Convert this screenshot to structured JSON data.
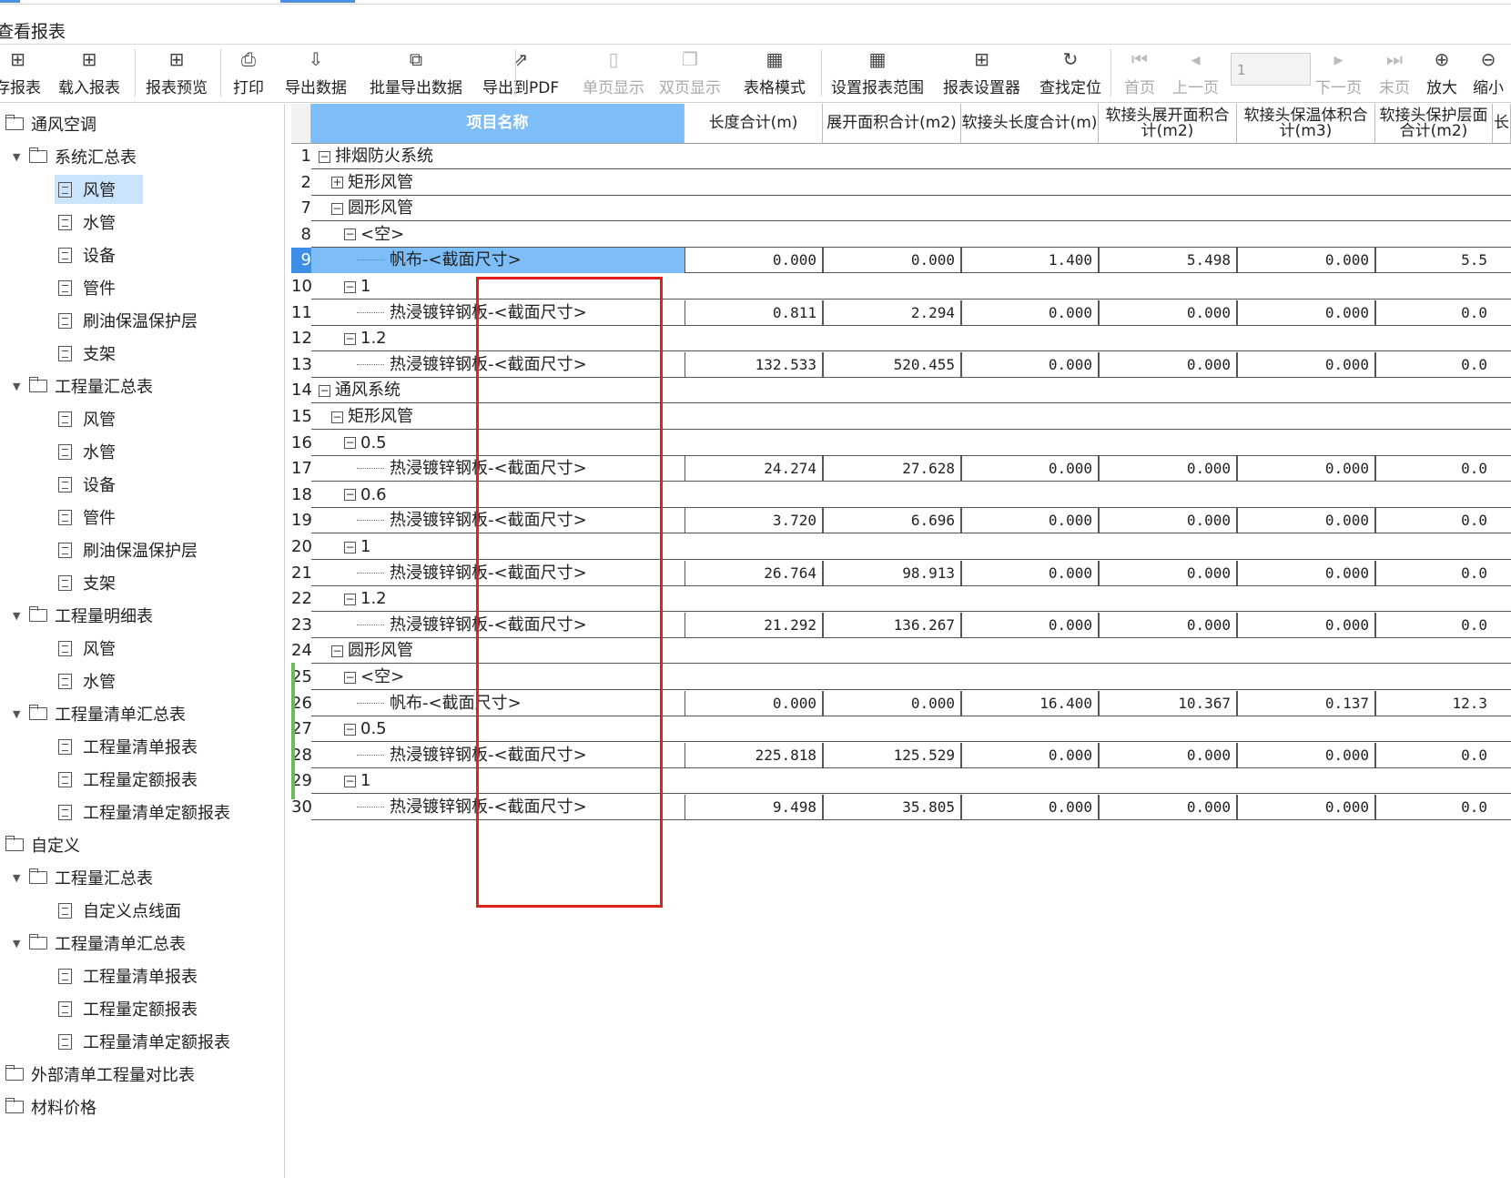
{
  "window": {
    "title": "查看报表"
  },
  "toolbar": {
    "items": [
      {
        "label": "存报表",
        "icon": "grid-save-icon",
        "enabled": true
      },
      {
        "label": "载入报表",
        "icon": "grid-load-icon",
        "enabled": true
      },
      {
        "label": "报表预览",
        "icon": "grid-preview-icon",
        "enabled": true
      },
      {
        "label": "打印",
        "icon": "printer-icon",
        "enabled": true
      },
      {
        "label": "导出数据",
        "icon": "export-data-icon",
        "enabled": true
      },
      {
        "label": "批量导出数据",
        "icon": "batch-export-icon",
        "enabled": true
      },
      {
        "label": "导出到PDF",
        "icon": "export-pdf-icon",
        "enabled": true
      },
      {
        "label": "单页显示",
        "icon": "single-page-icon",
        "enabled": false
      },
      {
        "label": "双页显示",
        "icon": "double-page-icon",
        "enabled": false
      },
      {
        "label": "表格模式",
        "icon": "table-mode-icon",
        "enabled": true
      },
      {
        "label": "设置报表范围",
        "icon": "report-range-icon",
        "enabled": true
      },
      {
        "label": "报表设置器",
        "icon": "report-settings-icon",
        "enabled": true
      },
      {
        "label": "查找定位",
        "icon": "refresh-find-icon",
        "enabled": true
      },
      {
        "label": "首页",
        "icon": "first-page-icon",
        "enabled": false
      },
      {
        "label": "上一页",
        "icon": "prev-page-icon",
        "enabled": false
      },
      {
        "label": "下一页",
        "icon": "next-page-icon",
        "enabled": false
      },
      {
        "label": "末页",
        "icon": "last-page-icon",
        "enabled": false
      },
      {
        "label": "放大",
        "icon": "zoom-in-icon",
        "enabled": true
      },
      {
        "label": "缩小",
        "icon": "zoom-out-icon",
        "enabled": true
      }
    ],
    "page_value": "1"
  },
  "tree": [
    {
      "label": "通风空调",
      "level": 0,
      "type": "folder",
      "arrow": false
    },
    {
      "label": "系统汇总表",
      "level": 1,
      "type": "folder",
      "arrow": true
    },
    {
      "label": "风管",
      "level": 2,
      "type": "doc",
      "selected": true
    },
    {
      "label": "水管",
      "level": 2,
      "type": "doc"
    },
    {
      "label": "设备",
      "level": 2,
      "type": "doc"
    },
    {
      "label": "管件",
      "level": 2,
      "type": "doc"
    },
    {
      "label": "刷油保温保护层",
      "level": 2,
      "type": "doc"
    },
    {
      "label": "支架",
      "level": 2,
      "type": "doc"
    },
    {
      "label": "工程量汇总表",
      "level": 1,
      "type": "folder",
      "arrow": true
    },
    {
      "label": "风管",
      "level": 2,
      "type": "doc"
    },
    {
      "label": "水管",
      "level": 2,
      "type": "doc"
    },
    {
      "label": "设备",
      "level": 2,
      "type": "doc"
    },
    {
      "label": "管件",
      "level": 2,
      "type": "doc"
    },
    {
      "label": "刷油保温保护层",
      "level": 2,
      "type": "doc"
    },
    {
      "label": "支架",
      "level": 2,
      "type": "doc"
    },
    {
      "label": "工程量明细表",
      "level": 1,
      "type": "folder",
      "arrow": true
    },
    {
      "label": "风管",
      "level": 2,
      "type": "doc"
    },
    {
      "label": "水管",
      "level": 2,
      "type": "doc"
    },
    {
      "label": "工程量清单汇总表",
      "level": 1,
      "type": "folder",
      "arrow": true
    },
    {
      "label": "工程量清单报表",
      "level": 2,
      "type": "doc"
    },
    {
      "label": "工程量定额报表",
      "level": 2,
      "type": "doc"
    },
    {
      "label": "工程量清单定额报表",
      "level": 2,
      "type": "doc"
    },
    {
      "label": "自定义",
      "level": 0,
      "type": "folder",
      "arrow": false
    },
    {
      "label": "工程量汇总表",
      "level": 1,
      "type": "folder",
      "arrow": true
    },
    {
      "label": "自定义点线面",
      "level": 2,
      "type": "doc"
    },
    {
      "label": "工程量清单汇总表",
      "level": 1,
      "type": "folder",
      "arrow": true
    },
    {
      "label": "工程量清单报表",
      "level": 2,
      "type": "doc"
    },
    {
      "label": "工程量定额报表",
      "level": 2,
      "type": "doc"
    },
    {
      "label": "工程量清单定额报表",
      "level": 2,
      "type": "doc"
    },
    {
      "label": "外部清单工程量对比表",
      "level": 0,
      "type": "folder",
      "arrow": false
    },
    {
      "label": "材料价格",
      "level": 0,
      "type": "folder",
      "arrow": false
    }
  ],
  "table": {
    "headers": [
      "项目名称",
      "长度合计(m)",
      "展开面积合计(m2)",
      "软接头长度合计(m)",
      "软接头展开面积合计(m2)",
      "软接头保温体积合计(m3)",
      "软接头保护层面合计(m2)",
      "长"
    ],
    "rows": [
      {
        "num": "1",
        "indent": 0,
        "expander": "−",
        "name": "排烟防火系统"
      },
      {
        "num": "2",
        "indent": 1,
        "expander": "+",
        "name": "矩形风管"
      },
      {
        "num": "7",
        "indent": 1,
        "expander": "−",
        "name": "圆形风管"
      },
      {
        "num": "8",
        "indent": 2,
        "expander": "−",
        "name": "<空>"
      },
      {
        "num": "9",
        "indent": 3,
        "leaf": true,
        "name": "帆布-<截面尺寸>",
        "values": [
          "0.000",
          "0.000",
          "1.400",
          "5.498",
          "0.000",
          "5.5"
        ],
        "selected": true
      },
      {
        "num": "10",
        "indent": 2,
        "expander": "−",
        "name": "1"
      },
      {
        "num": "11",
        "indent": 3,
        "leaf": true,
        "name": "热浸镀锌钢板-<截面尺寸>",
        "values": [
          "0.811",
          "2.294",
          "0.000",
          "0.000",
          "0.000",
          "0.0"
        ]
      },
      {
        "num": "12",
        "indent": 2,
        "expander": "−",
        "name": "1.2"
      },
      {
        "num": "13",
        "indent": 3,
        "leaf": true,
        "name": "热浸镀锌钢板-<截面尺寸>",
        "values": [
          "132.533",
          "520.455",
          "0.000",
          "0.000",
          "0.000",
          "0.0"
        ]
      },
      {
        "num": "14",
        "indent": 0,
        "expander": "−",
        "name": "通风系统"
      },
      {
        "num": "15",
        "indent": 1,
        "expander": "−",
        "name": "矩形风管"
      },
      {
        "num": "16",
        "indent": 2,
        "expander": "−",
        "name": "0.5"
      },
      {
        "num": "17",
        "indent": 3,
        "leaf": true,
        "name": "热浸镀锌钢板-<截面尺寸>",
        "values": [
          "24.274",
          "27.628",
          "0.000",
          "0.000",
          "0.000",
          "0.0"
        ]
      },
      {
        "num": "18",
        "indent": 2,
        "expander": "−",
        "name": "0.6"
      },
      {
        "num": "19",
        "indent": 3,
        "leaf": true,
        "name": "热浸镀锌钢板-<截面尺寸>",
        "values": [
          "3.720",
          "6.696",
          "0.000",
          "0.000",
          "0.000",
          "0.0"
        ]
      },
      {
        "num": "20",
        "indent": 2,
        "expander": "−",
        "name": "1"
      },
      {
        "num": "21",
        "indent": 3,
        "leaf": true,
        "name": "热浸镀锌钢板-<截面尺寸>",
        "values": [
          "26.764",
          "98.913",
          "0.000",
          "0.000",
          "0.000",
          "0.0"
        ]
      },
      {
        "num": "22",
        "indent": 2,
        "expander": "−",
        "name": "1.2"
      },
      {
        "num": "23",
        "indent": 3,
        "leaf": true,
        "name": "热浸镀锌钢板-<截面尺寸>",
        "values": [
          "21.292",
          "136.267",
          "0.000",
          "0.000",
          "0.000",
          "0.0"
        ]
      },
      {
        "num": "24",
        "indent": 1,
        "expander": "−",
        "name": "圆形风管"
      },
      {
        "num": "25",
        "indent": 2,
        "expander": "−",
        "name": "<空>"
      },
      {
        "num": "26",
        "indent": 3,
        "leaf": true,
        "name": "帆布-<截面尺寸>",
        "values": [
          "0.000",
          "0.000",
          "16.400",
          "10.367",
          "0.137",
          "12.3"
        ]
      },
      {
        "num": "27",
        "indent": 2,
        "expander": "−",
        "name": "0.5"
      },
      {
        "num": "28",
        "indent": 3,
        "leaf": true,
        "name": "热浸镀锌钢板-<截面尺寸>",
        "values": [
          "225.818",
          "125.529",
          "0.000",
          "0.000",
          "0.000",
          "0.0"
        ]
      },
      {
        "num": "29",
        "indent": 2,
        "expander": "−",
        "name": "1"
      },
      {
        "num": "30",
        "indent": 3,
        "leaf": true,
        "name": "热浸镀锌钢板-<截面尺寸>",
        "values": [
          "9.498",
          "35.805",
          "0.000",
          "0.000",
          "0.000",
          "0.0"
        ]
      }
    ]
  },
  "colors": {
    "accent": "#7dbef8",
    "selected_row": "#3c8ee6",
    "highlight_box": "#e0201c",
    "tree_selected": "#cce4fb"
  }
}
